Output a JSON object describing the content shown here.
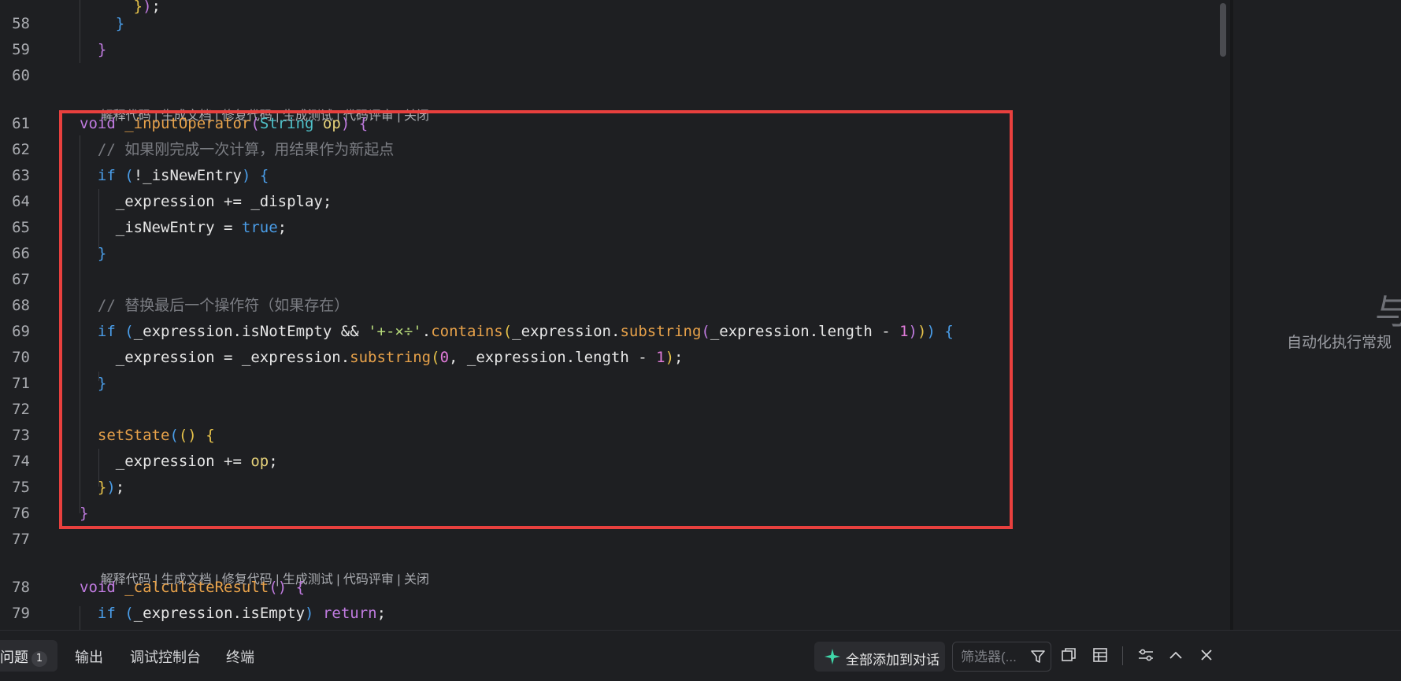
{
  "editor": {
    "line_numbers": [
      "58",
      "59",
      "60",
      "61",
      "62",
      "63",
      "64",
      "65",
      "66",
      "67",
      "68",
      "69",
      "70",
      "71",
      "72",
      "73",
      "74",
      "75",
      "76",
      "77",
      "78",
      "79"
    ],
    "codelens": {
      "explain": "解释代码",
      "gen_doc": "生成文档",
      "fix": "修复代码",
      "gen_test": "生成测试",
      "review": "代码评审",
      "close": "关闭",
      "sep": " | "
    },
    "comments": {
      "c62": "// 如果刚完成一次计算，用结果作为新起点",
      "c68": "// 替换最后一个操作符（如果存在）"
    },
    "strings": {
      "ops": "'+-×÷'"
    }
  },
  "right_pane": {
    "big_char": "与",
    "subtitle": "自动化执行常规"
  },
  "bottom_panel": {
    "tabs": [
      {
        "label": "问题",
        "badge": "1"
      },
      {
        "label": "输出"
      },
      {
        "label": "调试控制台"
      },
      {
        "label": "终端"
      }
    ],
    "add_all_label": "全部添加到对话",
    "filter_placeholder": "筛选器(..."
  },
  "colors": {
    "highlight_border": "#e8403e",
    "keyword": "#c07be0",
    "function": "#e8a24a",
    "comment": "#7a7c82",
    "string": "#b6d97a",
    "number": "#e07bd9"
  }
}
